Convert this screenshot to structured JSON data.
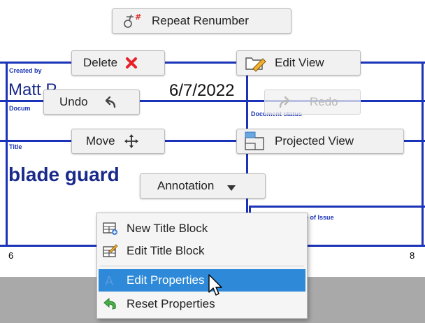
{
  "title_block": {
    "created_by_label": "Created by",
    "created_by_value": "Matt P",
    "date_value": "6/7/2022",
    "document_label": "Docum",
    "document_status_label": "Document status",
    "title_label": "Title",
    "title_value": "blade guard",
    "date_of_issue_label": "e of Issue"
  },
  "ruler": {
    "left": "6",
    "right": "8"
  },
  "marking_menu": {
    "repeat_renumber": "Repeat Renumber",
    "delete": "Delete",
    "edit_view": "Edit View",
    "undo": "Undo",
    "redo": "Redo",
    "move": "Move",
    "projected_view": "Projected View",
    "annotation": "Annotation"
  },
  "annotation_menu": {
    "items": [
      {
        "label": "New Title Block",
        "icon": "new-title-block-icon"
      },
      {
        "label": "Edit Title Block",
        "icon": "edit-title-block-icon"
      },
      {
        "label": "Edit Properties",
        "icon": "edit-properties-icon",
        "selected": true
      },
      {
        "label": "Reset Properties",
        "icon": "reset-properties-icon"
      }
    ]
  },
  "colors": {
    "title_block_blue": "#1a33b8",
    "selection": "#2e8ad8",
    "delete_red": "#e8202a",
    "bottom_band": "#a9a9a9"
  }
}
